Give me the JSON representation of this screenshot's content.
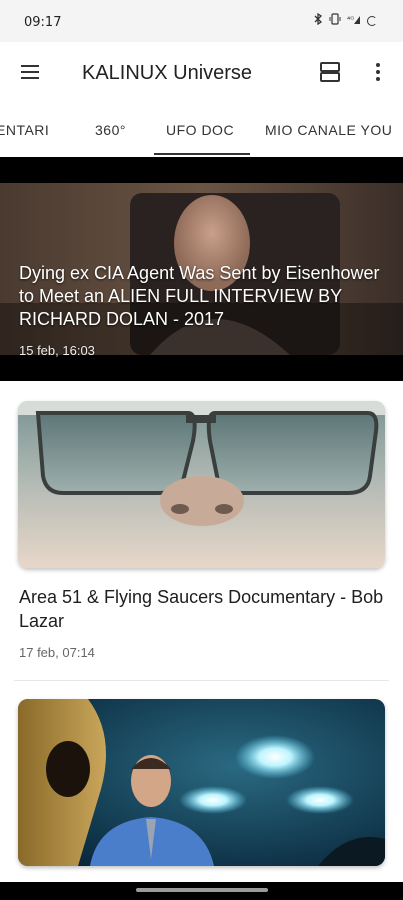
{
  "status_bar": {
    "time": "09:17",
    "icons": [
      "bluetooth-icon",
      "vibrate-icon",
      "signal-icon",
      "battery-icon"
    ]
  },
  "app_bar": {
    "title": "KALINUX Universe",
    "menu_icon": "menu-icon",
    "layout_icon": "view-agenda-icon",
    "more_icon": "more-vert-icon"
  },
  "tabs": [
    {
      "label": "ENTARI"
    },
    {
      "label": "360°"
    },
    {
      "label": "UFO DOC",
      "selected": true
    },
    {
      "label": "MIO CANALE YOU"
    }
  ],
  "feed": {
    "featured": {
      "title": "Dying ex CIA Agent Was Sent by Eisenhower to Meet an ALIEN FULL INTERVIEW BY RICHARD DOLAN - 2017",
      "date": "15 feb, 16:03"
    },
    "items": [
      {
        "title": "Area 51 & Flying Saucers Documentary - Bob Lazar",
        "date": "17 feb, 07:14"
      },
      {
        "title": "",
        "date": ""
      }
    ]
  },
  "colors": {
    "status_bg": "#f4f4f4",
    "accent": "#333333",
    "hero_bg": "#000000"
  }
}
